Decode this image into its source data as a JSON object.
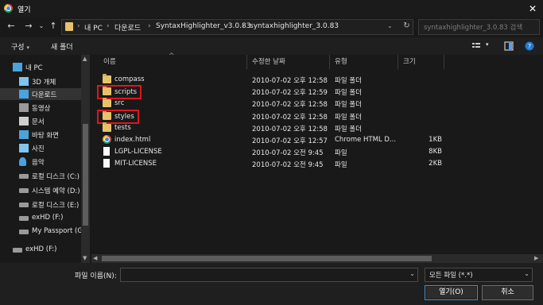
{
  "window": {
    "title": "열기",
    "close_glyph": "✕"
  },
  "nav": {
    "back_glyph": "←",
    "forward_glyph": "→",
    "dropdown_glyph": "⌄",
    "up_glyph": "↑",
    "breadcrumb": [
      "내 PC",
      "다운로드",
      "SyntaxHighlighter_v3.0.83",
      "syntaxhighlighter_3.0.83"
    ],
    "separator": "›",
    "refresh_glyph": "↻",
    "search_placeholder": "syntaxhighlighter_3.0.83 검색"
  },
  "toolbar": {
    "organize_label": "구성",
    "new_folder_label": "새 폴더",
    "caret": "▾"
  },
  "sidebar": {
    "items": [
      {
        "label": "내 PC",
        "icon": "pc-icon"
      },
      {
        "label": "3D 개체",
        "icon": "cube-icon"
      },
      {
        "label": "다운로드",
        "icon": "download-icon"
      },
      {
        "label": "동영상",
        "icon": "video-icon"
      },
      {
        "label": "문서",
        "icon": "document-icon"
      },
      {
        "label": "바탕 화면",
        "icon": "desktop-icon"
      },
      {
        "label": "사진",
        "icon": "picture-icon"
      },
      {
        "label": "음악",
        "icon": "music-icon"
      },
      {
        "label": "로컬 디스크 (C:)",
        "icon": "drive-icon"
      },
      {
        "label": "시스템 예약 (D:)",
        "icon": "drive-icon"
      },
      {
        "label": "로컬 디스크 (E:)",
        "icon": "drive-icon"
      },
      {
        "label": "exHD (F:)",
        "icon": "drive-icon"
      },
      {
        "label": "My Passport (G:)",
        "icon": "drive-icon"
      },
      {
        "label": "exHD (F:)",
        "icon": "drive-icon"
      }
    ],
    "selected_index": 2
  },
  "columns": {
    "name": "이름",
    "modified": "수정한 날짜",
    "type": "유형",
    "size": "크기",
    "sort_glyph": "^"
  },
  "files": [
    {
      "name": "compass",
      "modified": "2010-07-02 오후 12:58",
      "type": "파일 폴더",
      "size": "",
      "kind": "folder"
    },
    {
      "name": "scripts",
      "modified": "2010-07-02 오후 12:59",
      "type": "파일 폴더",
      "size": "",
      "kind": "folder",
      "highlighted": true
    },
    {
      "name": "src",
      "modified": "2010-07-02 오후 12:58",
      "type": "파일 폴더",
      "size": "",
      "kind": "folder"
    },
    {
      "name": "styles",
      "modified": "2010-07-02 오후 12:58",
      "type": "파일 폴더",
      "size": "",
      "kind": "folder",
      "highlighted": true
    },
    {
      "name": "tests",
      "modified": "2010-07-02 오후 12:58",
      "type": "파일 폴더",
      "size": "",
      "kind": "folder"
    },
    {
      "name": "index.html",
      "modified": "2010-07-02 오후 12:57",
      "type": "Chrome HTML D...",
      "size": "1KB",
      "kind": "chrome"
    },
    {
      "name": "LGPL-LICENSE",
      "modified": "2010-07-02 오전 9:45",
      "type": "파일",
      "size": "8KB",
      "kind": "file"
    },
    {
      "name": "MIT-LICENSE",
      "modified": "2010-07-02 오전 9:45",
      "type": "파일",
      "size": "2KB",
      "kind": "file"
    }
  ],
  "bottom": {
    "filename_label": "파일 이름(N):",
    "filename_value": "",
    "filter_value": "모든 파일 (*.*)",
    "open_label": "열기(O)",
    "cancel_label": "취소",
    "dropdown_glyph": "⌄"
  },
  "colors": {
    "highlight": "#e0141e",
    "folder": "#e8c26b",
    "primary_border": "#3c8fd8"
  }
}
